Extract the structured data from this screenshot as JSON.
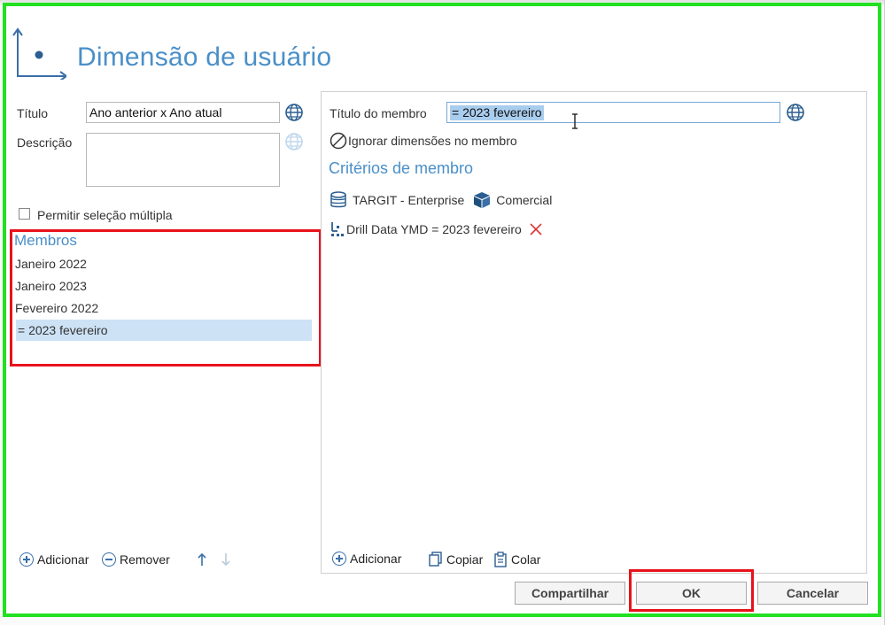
{
  "dialog": {
    "title": "Dimensão de usuário"
  },
  "form": {
    "title_label": "Título",
    "title_value": "Ano anterior x Ano atual",
    "description_label": "Descrição",
    "description_value": "",
    "multi_select_label": "Permitir seleção múltipla",
    "multi_select_checked": false
  },
  "members": {
    "heading": "Membros",
    "items": [
      "Janeiro 2022",
      "Janeiro 2023",
      "Fevereiro 2022",
      "= 2023 fevereiro"
    ],
    "selected_index": 3,
    "add_label": "Adicionar",
    "remove_label": "Remover"
  },
  "member_detail": {
    "title_label": "Título do membro",
    "title_value": "= 2023 fevereiro",
    "ignore_dims_label": "Ignorar dimensões no membro",
    "criteria_heading": "Critérios de membro",
    "source_db": "TARGIT - Enterprise",
    "source_cube": "Comercial",
    "criterion": "Drill Data YMD = 2023 fevereiro",
    "add_label": "Adicionar",
    "copy_label": "Copiar",
    "paste_label": "Colar"
  },
  "footer": {
    "share_label": "Compartilhar",
    "ok_label": "OK",
    "cancel_label": "Cancelar"
  },
  "colors": {
    "accent": "#4a8fc8",
    "highlight_green": "#22e022",
    "highlight_red": "#e8121b",
    "selection": "#cde2f5"
  }
}
